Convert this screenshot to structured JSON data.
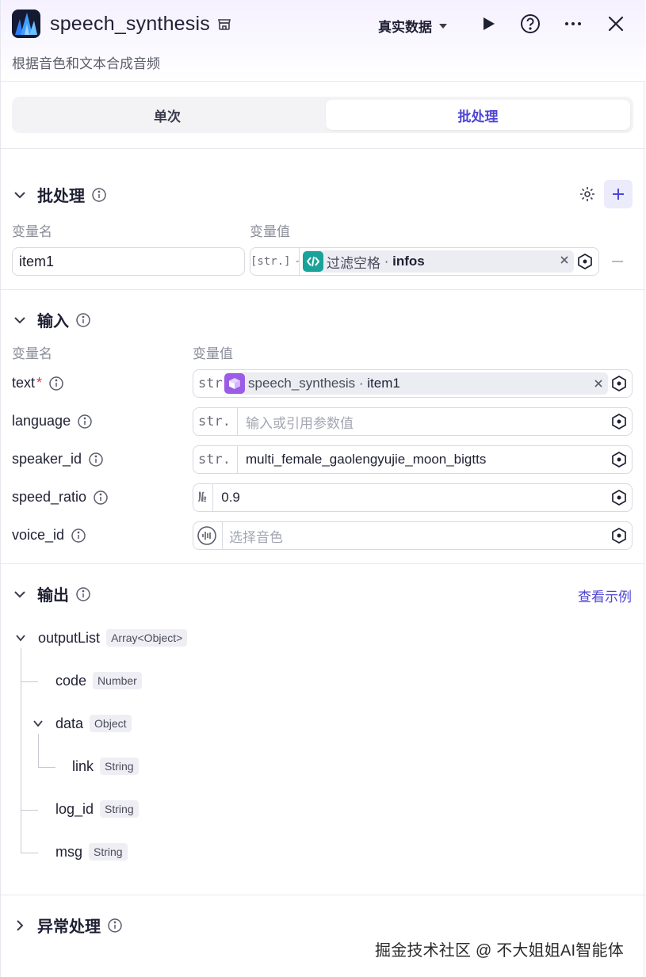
{
  "header": {
    "title": "speech_synthesis",
    "subtitle": "根据音色和文本合成音频",
    "data_mode": "真实数据"
  },
  "tabs": [
    {
      "label": "单次",
      "active": false
    },
    {
      "label": "批处理",
      "active": true
    }
  ],
  "batch": {
    "section_title": "批处理",
    "col_name": "变量名",
    "col_value": "变量值",
    "var_name": "item1",
    "type_tag": "[str.]",
    "ref_node": "过滤空格",
    "ref_sep": " · ",
    "ref_field": "infos"
  },
  "input": {
    "section_title": "输入",
    "col_name": "变量名",
    "col_value": "变量值",
    "params": [
      {
        "name": "text",
        "required": true,
        "type": "str.",
        "ref_node": "speech_synthesis",
        "ref_field": "item1"
      },
      {
        "name": "language",
        "type": "str.",
        "placeholder": "输入或引用参数值"
      },
      {
        "name": "speaker_id",
        "type": "str.",
        "value": "multi_female_gaolengyujie_moon_bigtts"
      },
      {
        "name": "speed_ratio",
        "type": "№",
        "value": "0.9"
      },
      {
        "name": "voice_id",
        "placeholder": "选择音色"
      }
    ],
    "required_mark": "*"
  },
  "output": {
    "section_title": "输出",
    "view_example": "查看示例",
    "tree": [
      {
        "name": "outputList",
        "type": "Array<Object>"
      },
      {
        "name": "code",
        "type": "Number"
      },
      {
        "name": "data",
        "type": "Object"
      },
      {
        "name": "link",
        "type": "String"
      },
      {
        "name": "log_id",
        "type": "String"
      },
      {
        "name": "msg",
        "type": "String"
      }
    ]
  },
  "exception": {
    "section_title": "异常处理"
  },
  "watermark": "掘金技术社区 @ 不大姐姐AI智能体",
  "colors": {
    "accent": "#4e46d6",
    "code_node": "#1aa39a",
    "start_node": "#9b5de5"
  }
}
